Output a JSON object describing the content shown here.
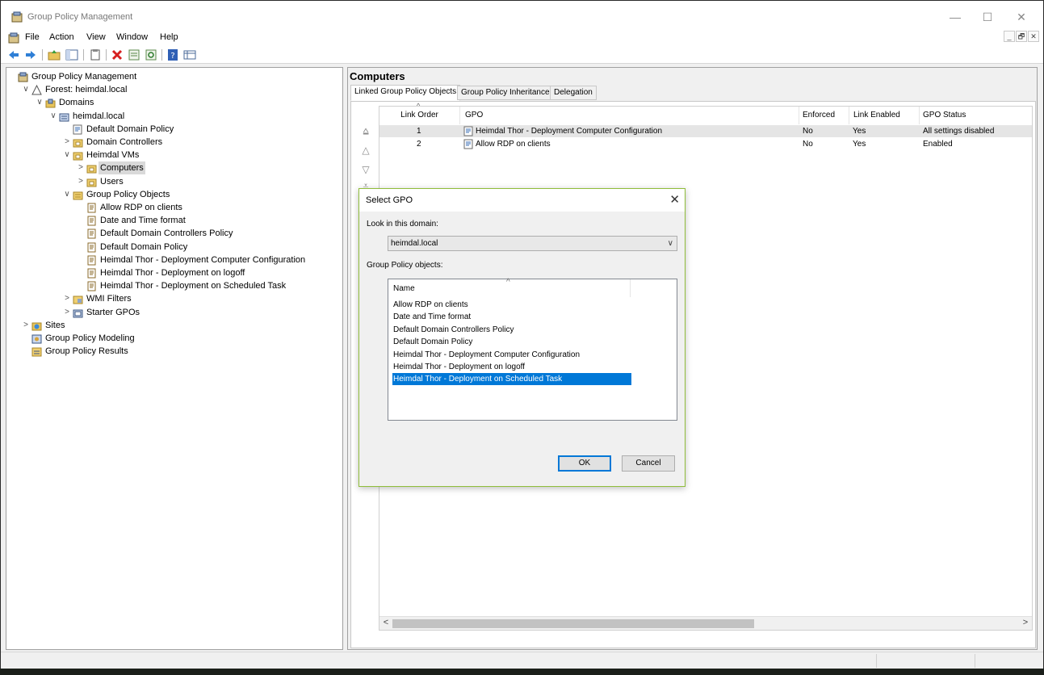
{
  "window": {
    "title": "Group Policy Management",
    "minimize": "—",
    "maximize": "☐",
    "close": "✕"
  },
  "menu": [
    "File",
    "Action",
    "View",
    "Window",
    "Help"
  ],
  "mdi_buttons": [
    "_",
    "🗗",
    "✕"
  ],
  "tree": [
    {
      "label": "Group Policy Management",
      "indent": 0,
      "expander": "",
      "icon": "gpm-icon"
    },
    {
      "label": "Forest: heimdal.local",
      "indent": 1,
      "expander": "∨",
      "icon": "forest-icon"
    },
    {
      "label": "Domains",
      "indent": 2,
      "expander": "∨",
      "icon": "domains-icon"
    },
    {
      "label": "heimdal.local",
      "indent": 3,
      "expander": "∨",
      "icon": "domain-icon"
    },
    {
      "label": "Default Domain Policy",
      "indent": 4,
      "expander": "",
      "icon": "gpo-link-icon"
    },
    {
      "label": "Domain Controllers",
      "indent": 4,
      "expander": ">",
      "icon": "ou-icon"
    },
    {
      "label": "Heimdal VMs",
      "indent": 4,
      "expander": "∨",
      "icon": "ou-icon"
    },
    {
      "label": "Computers",
      "indent": 5,
      "expander": ">",
      "icon": "ou-icon",
      "selected": true
    },
    {
      "label": "Users",
      "indent": 5,
      "expander": ">",
      "icon": "ou-icon"
    },
    {
      "label": "Group Policy Objects",
      "indent": 4,
      "expander": "∨",
      "icon": "gpo-folder-icon"
    },
    {
      "label": "Allow RDP on clients",
      "indent": 5,
      "expander": "",
      "icon": "gpo-icon"
    },
    {
      "label": "Date and Time format",
      "indent": 5,
      "expander": "",
      "icon": "gpo-icon"
    },
    {
      "label": "Default Domain Controllers Policy",
      "indent": 5,
      "expander": "",
      "icon": "gpo-icon"
    },
    {
      "label": "Default Domain Policy",
      "indent": 5,
      "expander": "",
      "icon": "gpo-icon"
    },
    {
      "label": "Heimdal Thor - Deployment Computer Configuration",
      "indent": 5,
      "expander": "",
      "icon": "gpo-icon"
    },
    {
      "label": "Heimdal Thor - Deployment on logoff",
      "indent": 5,
      "expander": "",
      "icon": "gpo-icon"
    },
    {
      "label": "Heimdal Thor - Deployment on Scheduled Task",
      "indent": 5,
      "expander": "",
      "icon": "gpo-icon"
    },
    {
      "label": "WMI Filters",
      "indent": 4,
      "expander": ">",
      "icon": "wmi-folder-icon"
    },
    {
      "label": "Starter GPOs",
      "indent": 4,
      "expander": ">",
      "icon": "starter-gpo-icon"
    },
    {
      "label": "Sites",
      "indent": 1,
      "expander": ">",
      "icon": "sites-icon"
    },
    {
      "label": "Group Policy Modeling",
      "indent": 1,
      "expander": "",
      "icon": "modeling-icon"
    },
    {
      "label": "Group Policy Results",
      "indent": 1,
      "expander": "",
      "icon": "results-icon"
    }
  ],
  "right_pane": {
    "title": "Computers",
    "tabs": [
      "Linked Group Policy Objects",
      "Group Policy Inheritance",
      "Delegation"
    ],
    "columns": [
      "Link Order",
      "GPO",
      "Enforced",
      "Link Enabled",
      "GPO Status"
    ],
    "rows": [
      {
        "order": "1",
        "gpo": "Heimdal Thor - Deployment Computer Configuration",
        "enforced": "No",
        "link_enabled": "Yes",
        "status": "All settings disabled"
      },
      {
        "order": "2",
        "gpo": "Allow RDP on clients",
        "enforced": "No",
        "link_enabled": "Yes",
        "status": "Enabled"
      }
    ],
    "scroll_left": "<",
    "scroll_right": ">"
  },
  "dialog": {
    "title": "Select GPO",
    "close": "✕",
    "look_in_label": "Look in this domain:",
    "domain_value": "heimdal.local",
    "objects_label": "Group Policy objects:",
    "list_header": "Name",
    "items": [
      "Allow RDP on clients",
      "Date and Time format",
      "Default Domain Controllers Policy",
      "Default Domain Policy",
      "Heimdal Thor - Deployment Computer Configuration",
      "Heimdal Thor - Deployment on logoff",
      "Heimdal Thor - Deployment on Scheduled Task"
    ],
    "selected_item": "Heimdal Thor - Deployment on Scheduled Task",
    "ok": "OK",
    "cancel": "Cancel"
  },
  "colors": {
    "selection_blue": "#0078d7",
    "dialog_border": "#8fbd3a",
    "delete_red": "#d61f1f"
  }
}
